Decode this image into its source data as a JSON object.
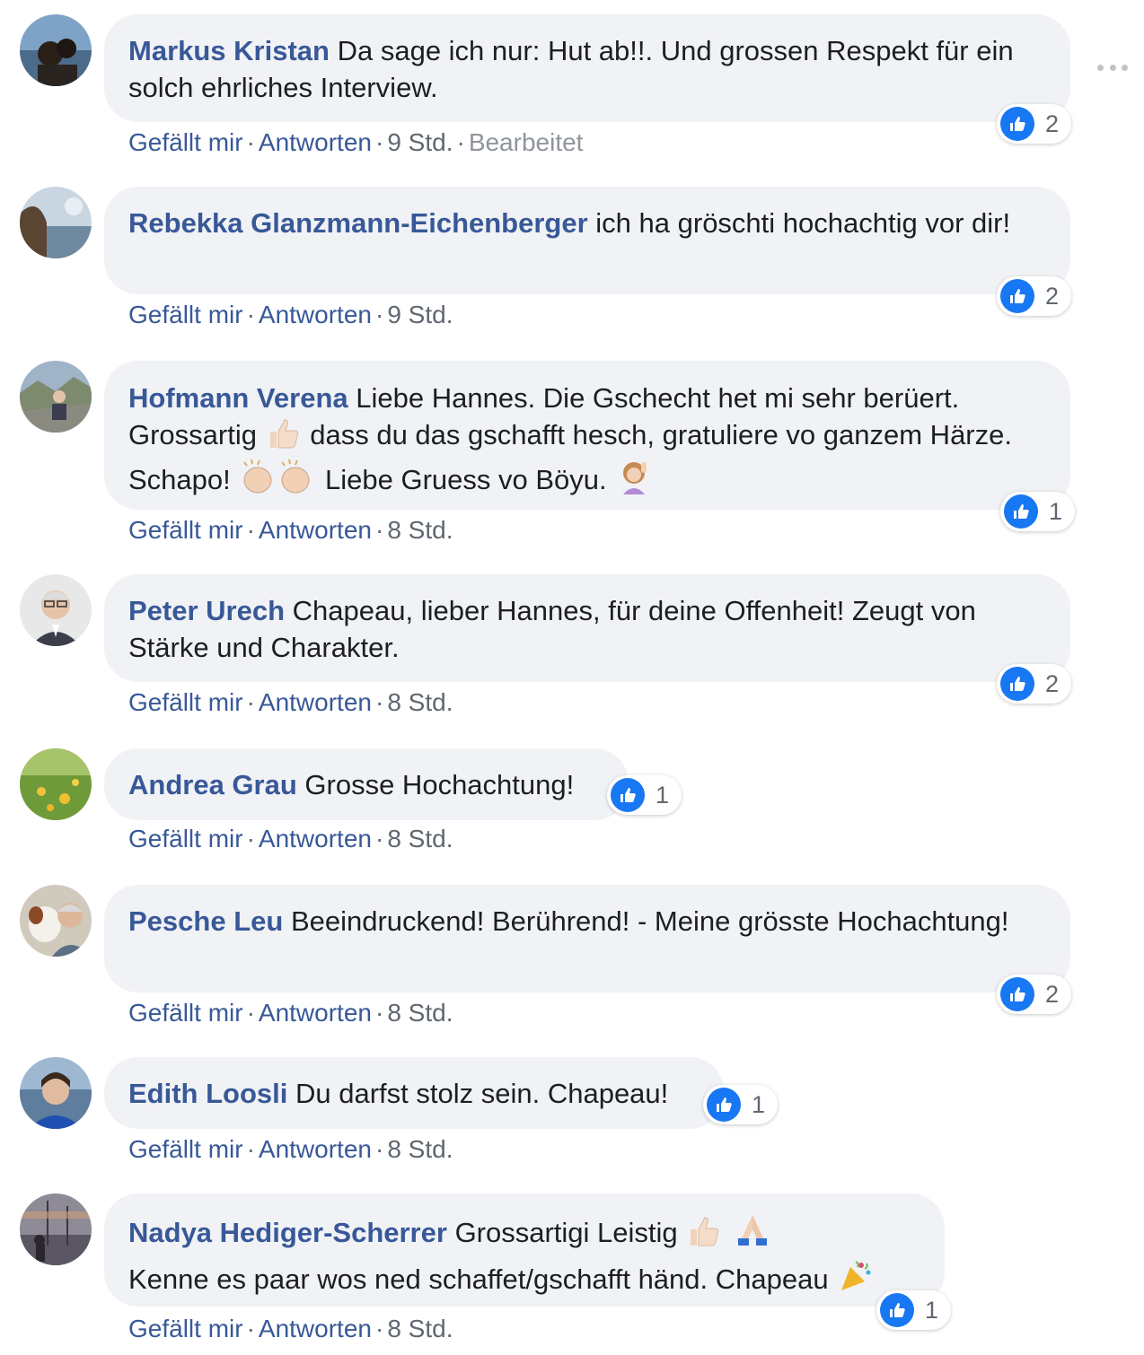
{
  "colors": {
    "author": "#385898",
    "bubble": "#f0f2f5",
    "like": "#1877f2",
    "meta": "#606770"
  },
  "comments": [
    {
      "author": "Markus Kristan",
      "text_parts": [
        "Da sage ich nur: Hut ab!!. Und grossen Respekt für ein solch ehrliches Interview."
      ],
      "like_label": "Gefällt mir",
      "reply_label": "Antworten",
      "time": "9 Std.",
      "edited": "Bearbeitet",
      "reactions": "2",
      "reaction_icon": "like-icon"
    },
    {
      "author": "Rebekka Glanzmann-Eichenberger",
      "text_parts": [
        "ich ha gröschti hochachtig vor dir!"
      ],
      "like_label": "Gefällt mir",
      "reply_label": "Antworten",
      "time": "9 Std.",
      "reactions": "2",
      "reaction_icon": "like-icon"
    },
    {
      "author": "Hofmann Verena",
      "text_parts": [
        "Liebe Hannes. Die Gschecht het mi sehr berüert. Grossartig",
        "dass du das gschafft hesch, gratuliere vo ganzem Härze. Schapo!",
        "Liebe Gruess vo Böyu."
      ],
      "emojis": [
        "thumbs-up-emoji",
        "clapping-hands-emoji",
        "waving-woman-emoji"
      ],
      "like_label": "Gefällt mir",
      "reply_label": "Antworten",
      "time": "8 Std.",
      "reactions": "1",
      "reaction_icon": "like-icon"
    },
    {
      "author": "Peter Urech",
      "text_parts": [
        "Chapeau, lieber Hannes, für deine Offenheit! Zeugt von Stärke und Charakter."
      ],
      "like_label": "Gefällt mir",
      "reply_label": "Antworten",
      "time": "8 Std.",
      "reactions": "2",
      "reaction_icon": "like-icon"
    },
    {
      "author": "Andrea Grau",
      "text_parts": [
        "Grosse Hochachtung!"
      ],
      "like_label": "Gefällt mir",
      "reply_label": "Antworten",
      "time": "8 Std.",
      "reactions": "1",
      "reaction_icon": "like-icon"
    },
    {
      "author": "Pesche Leu",
      "text_parts": [
        "Beeindruckend! Berührend! - Meine grösste Hochachtung!"
      ],
      "like_label": "Gefällt mir",
      "reply_label": "Antworten",
      "time": "8 Std.",
      "reactions": "2",
      "reaction_icon": "like-icon"
    },
    {
      "author": "Edith Loosli",
      "text_parts": [
        "Du darfst stolz sein. Chapeau!"
      ],
      "like_label": "Gefällt mir",
      "reply_label": "Antworten",
      "time": "8 Std.",
      "reactions": "1",
      "reaction_icon": "like-icon"
    },
    {
      "author": "Nadya Hediger-Scherrer",
      "text_parts": [
        "Grossartigi Leistig",
        "Kenne es paar wos ned schaffet/gschafft händ. Chapeau"
      ],
      "emojis": [
        "thumbs-up-emoji",
        "folded-hands-emoji",
        "party-popper-emoji"
      ],
      "like_label": "Gefällt mir",
      "reply_label": "Antworten",
      "time": "8 Std.",
      "reactions": "1",
      "reaction_icon": "like-icon"
    }
  ],
  "more_icon": "more-options-icon"
}
